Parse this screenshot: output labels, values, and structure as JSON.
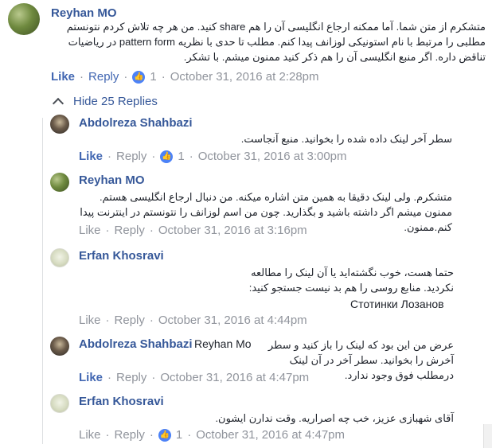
{
  "comment": {
    "author": "Reyhan MO",
    "text": "متشکرم از متن شما. آما ممکنه ارجاع انگلیسی آن را هم share کنید. من هر چه تلاش کردم نتونستم مطلبی را مرتبط با نام استونیکی لوزانف پیدا کنم. مطلب تا حدی با نظریه pattern form در ریاضیات تناقض داره. اگر منبع انگلیسی آن را هم ذکر کنید ممنون میشم. با تشکر.",
    "like": "Like",
    "reply": "Reply",
    "reactions": "1",
    "time": "October 31, 2016 at 2:28pm"
  },
  "hide_replies": "Hide 25 Replies",
  "replies": [
    {
      "author": "Abdolreza Shahbazi",
      "text": "سطر آخر لینک داده شده را بخوانید. منبع آنجاست.",
      "like": "Like",
      "reply": "Reply",
      "reactions": "1",
      "time": "October 31, 2016 at 3:00pm"
    },
    {
      "author": "Reyhan MO",
      "text": "متشکرم. ولی لینک دقیقا به همین متن اشاره میکنه. من دنبال ارجاع انگلیسی هستم. ممنون میشم اگر داشته باشید و بگذارید. چون من اسم لوزانف را نتونستم در اینترنت پیدا کنم.ممنون.",
      "like": "Like",
      "reply": "Reply",
      "time": "October 31, 2016 at 3:16pm"
    },
    {
      "author": "Erfan Khosravi",
      "text": "حتما هست، خوب نگشته‌اید یا آن لینک را مطالعه نکردید. منابع روسی را هم بد نیست جستجو کنید:",
      "extra": "Стотинки Лозанов",
      "like": "Like",
      "reply": "Reply",
      "time": "October 31, 2016 at 4:44pm"
    },
    {
      "author": "Abdolreza Shahbazi",
      "mention": "Reyhan Mo",
      "text": "عرض من این بود که لینک را باز کنید و سطر آخرش را بخوانید. سطر آخر در آن لینک درمطلب فوق وجود ندارد.",
      "like": "Like",
      "reply": "Reply",
      "time": "October 31, 2016 at 4:47pm"
    },
    {
      "author": "Erfan Khosravi",
      "text": "آقای شهبازی عزیز، خب چه اصراریه. وقت ندارن ایشون.",
      "like": "Like",
      "reply": "Reply",
      "reactions": "1",
      "time": "October 31, 2016 at 4:47pm"
    }
  ],
  "colors": {
    "link": "#365899",
    "action": "#4267b2",
    "meta": "#90949c",
    "reaction": "#4c82f7"
  }
}
